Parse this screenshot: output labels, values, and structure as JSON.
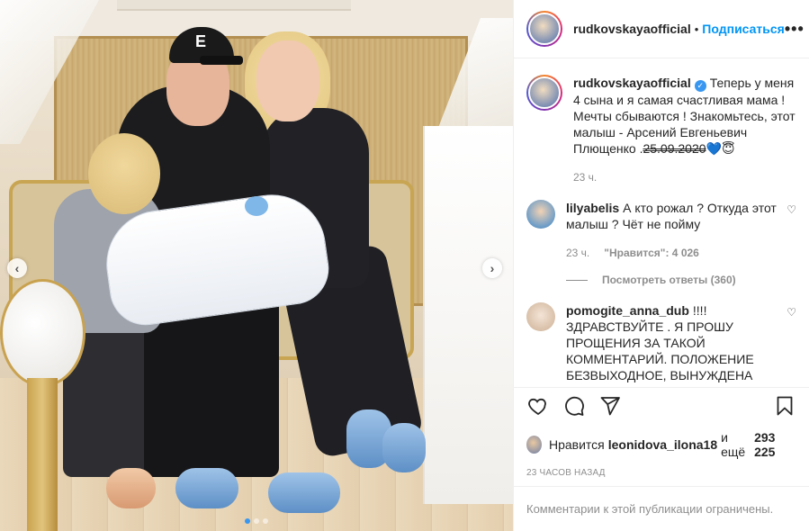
{
  "post": {
    "username": "rudkovskayaofficial",
    "follow_label": "Подписаться",
    "separator": "•",
    "more_label": "•••"
  },
  "caption": {
    "username": "rudkovskayaofficial",
    "text": "Теперь у меня 4 сына и я самая счастливая мама ! Мечты сбываются ! Знакомьтесь, этот малыш - Арсений Евгеньевич Плющенко .",
    "date": "25.09.2020",
    "emoji": "💙😇",
    "time": "23 ч."
  },
  "comments": [
    {
      "username": "lilyabelis",
      "text": "А кто рожал ? Откуда этот малыш ? Чёт не пойму",
      "time": "23 ч.",
      "likes": "\"Нравится\": 4 026",
      "replies_label": "Посмотреть ответы (360)"
    },
    {
      "username": "pomogite_anna_dub",
      "text": "!!!! ЗДРАВСТВУЙТЕ . Я ПРОШУ ПРОЩЕНИЯ ЗА ТАКОЙ КОММЕНТАРИЙ. ПОЛОЖЕНИЕ БЕЗВЫХОДНОЕ, ВЫНУЖДЕНА"
    }
  ],
  "likes_bar": {
    "prefix": "Нравится",
    "user": "leonidova_ilona18",
    "and_more": "и ещё",
    "count": "293 225"
  },
  "timestamp": "23 ЧАСОВ НАЗАД",
  "comments_restricted": "Комментарии к этой публикации ограничены.",
  "photo": {
    "cap_letter": "E",
    "prev_arrow": "‹",
    "next_arrow": "›",
    "dots": 3
  },
  "colors": {
    "accent": "#0095f6",
    "verified": "#3897f0",
    "muted": "#8e8e8e"
  }
}
